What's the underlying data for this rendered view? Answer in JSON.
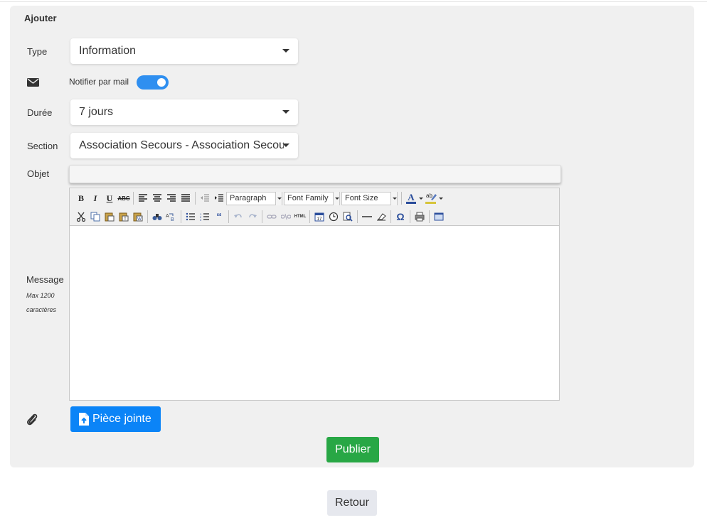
{
  "panel": {
    "title": "Ajouter"
  },
  "type": {
    "label": "Type",
    "value": "Information"
  },
  "notify": {
    "label": "Notifier par mail",
    "enabled": true,
    "icon": "envelope-icon"
  },
  "duree": {
    "label": "Durée",
    "value": "7 jours"
  },
  "section": {
    "label": "Section",
    "value": "Association Secours - Association Secours"
  },
  "objet": {
    "label": "Objet",
    "value": ""
  },
  "editor": {
    "format_select": "Paragraph",
    "font_family_select": "Font Family",
    "font_size_select": "Font Size",
    "html_button": "HTML",
    "omega": "Ω",
    "content": ""
  },
  "message": {
    "label": "Message",
    "hint_line1": "Max 1200",
    "hint_line2": "caractères"
  },
  "attachment": {
    "button": "Pièce jointe",
    "icon": "paperclip-icon"
  },
  "actions": {
    "publish": "Publier",
    "back": "Retour"
  },
  "colors": {
    "accent_blue": "#0b84f7",
    "toggle_blue": "#2f8ff0",
    "publish_green": "#28a745",
    "panel_bg": "#f0f0f0"
  }
}
